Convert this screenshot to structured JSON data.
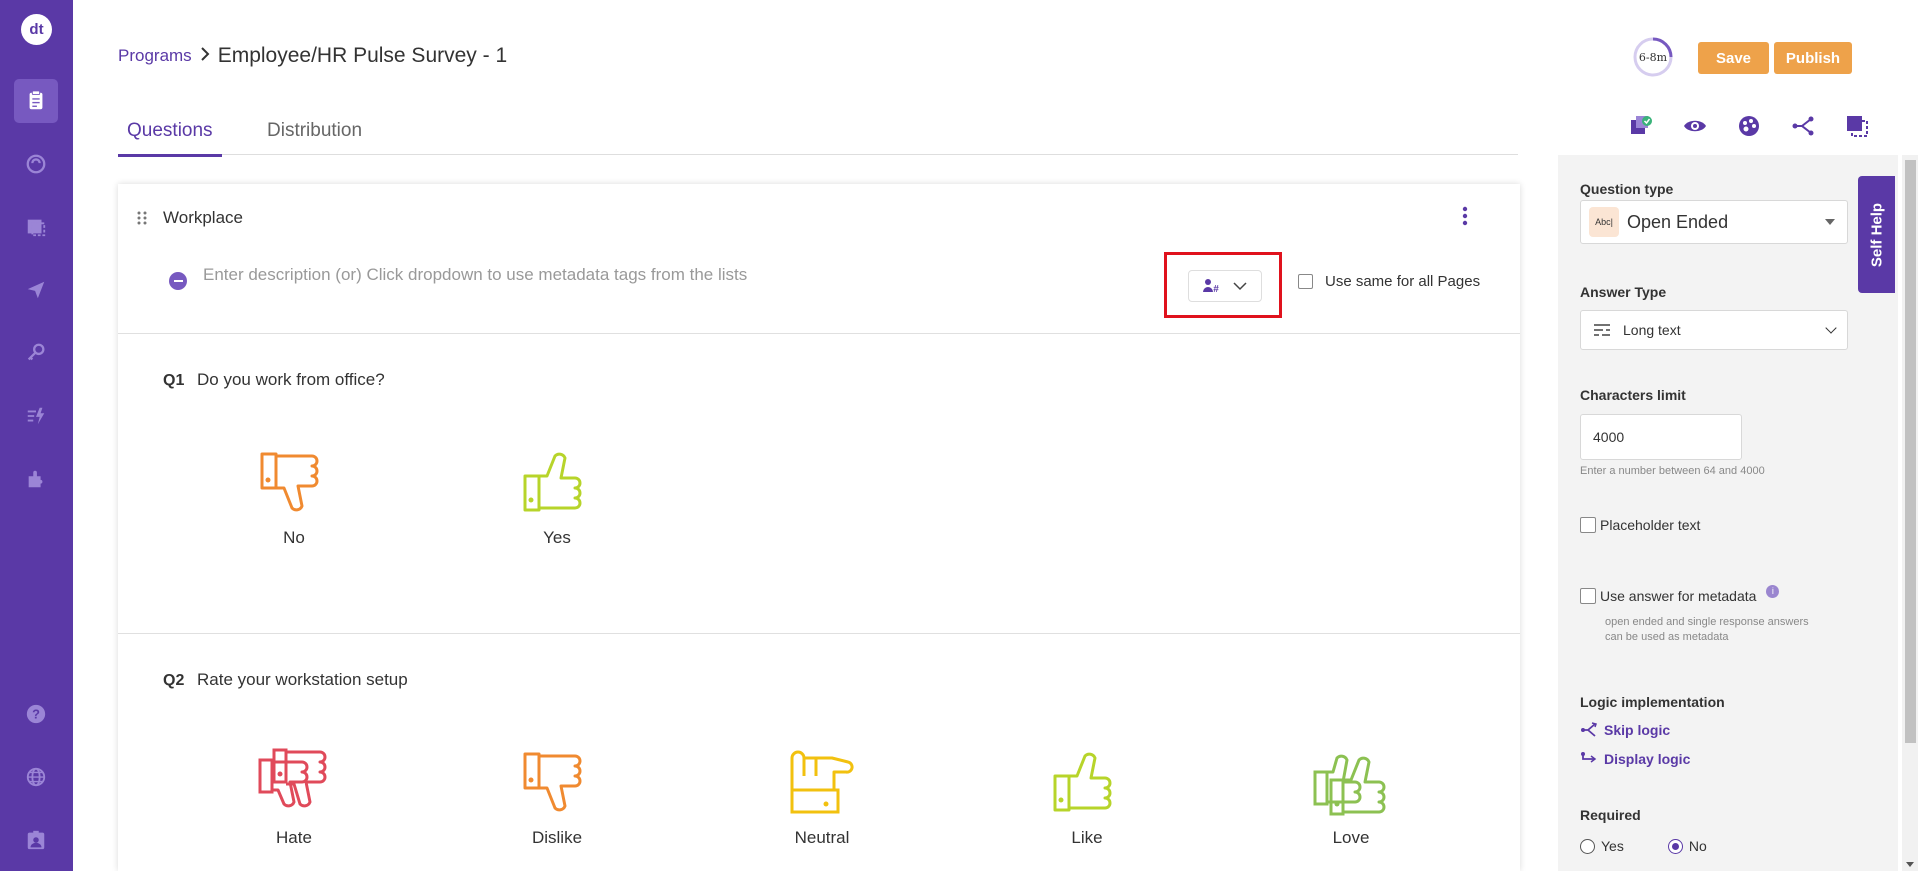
{
  "sidebar": {
    "logo": "dt",
    "items": [
      {
        "name": "surveys-icon",
        "active": true
      },
      {
        "name": "dashboard-icon"
      },
      {
        "name": "pages-icon"
      },
      {
        "name": "send-icon"
      },
      {
        "name": "key-icon"
      },
      {
        "name": "actions-icon"
      },
      {
        "name": "integrations-icon"
      },
      {
        "name": "help-icon"
      },
      {
        "name": "globe-icon"
      },
      {
        "name": "profile-icon"
      }
    ]
  },
  "header": {
    "breadcrumb_link": "Programs",
    "title": "Employee/HR Pulse Survey - 1",
    "timer": "6-8m",
    "save_label": "Save",
    "publish_label": "Publish"
  },
  "tabs": [
    {
      "label": "Questions",
      "active": true
    },
    {
      "label": "Distribution",
      "active": false
    }
  ],
  "page": {
    "title": "Workplace",
    "description_placeholder": "Enter description (or) Click dropdown to use metadata tags from the lists",
    "use_same_label": "Use same for all Pages"
  },
  "questions": [
    {
      "number": "Q1",
      "text": "Do you work from office?",
      "options": [
        "No",
        "Yes"
      ]
    },
    {
      "number": "Q2",
      "text": "Rate your workstation setup",
      "options": [
        "Hate",
        "Dislike",
        "Neutral",
        "Like",
        "Love"
      ]
    }
  ],
  "panel": {
    "question_type_label": "Question type",
    "question_type_value": "Open Ended",
    "question_type_icon_text": "Abc|",
    "answer_type_label": "Answer Type",
    "answer_type_value": "Long text",
    "chars_limit_label": "Characters limit",
    "chars_limit_value": "4000",
    "chars_hint": "Enter a number between 64 and 4000",
    "placeholder_label": "Placeholder text",
    "metadata_label": "Use answer for metadata",
    "metadata_hint_1": "open ended and single response answers",
    "metadata_hint_2": "can be used as metadata",
    "logic_label": "Logic implementation",
    "skip_logic": "Skip logic",
    "display_logic": "Display logic",
    "required_label": "Required",
    "required_yes": "Yes",
    "required_no": "No",
    "required_value": "No"
  },
  "self_help": "Self Help",
  "colors": {
    "brand": "#5a39a6",
    "accent": "#eea24a",
    "highlight": "#e0121d",
    "hate": "#e04a5a",
    "dislike": "#f08a30",
    "neutral": "#f2c10f",
    "like": "#b7d42a",
    "love": "#8cc152"
  }
}
